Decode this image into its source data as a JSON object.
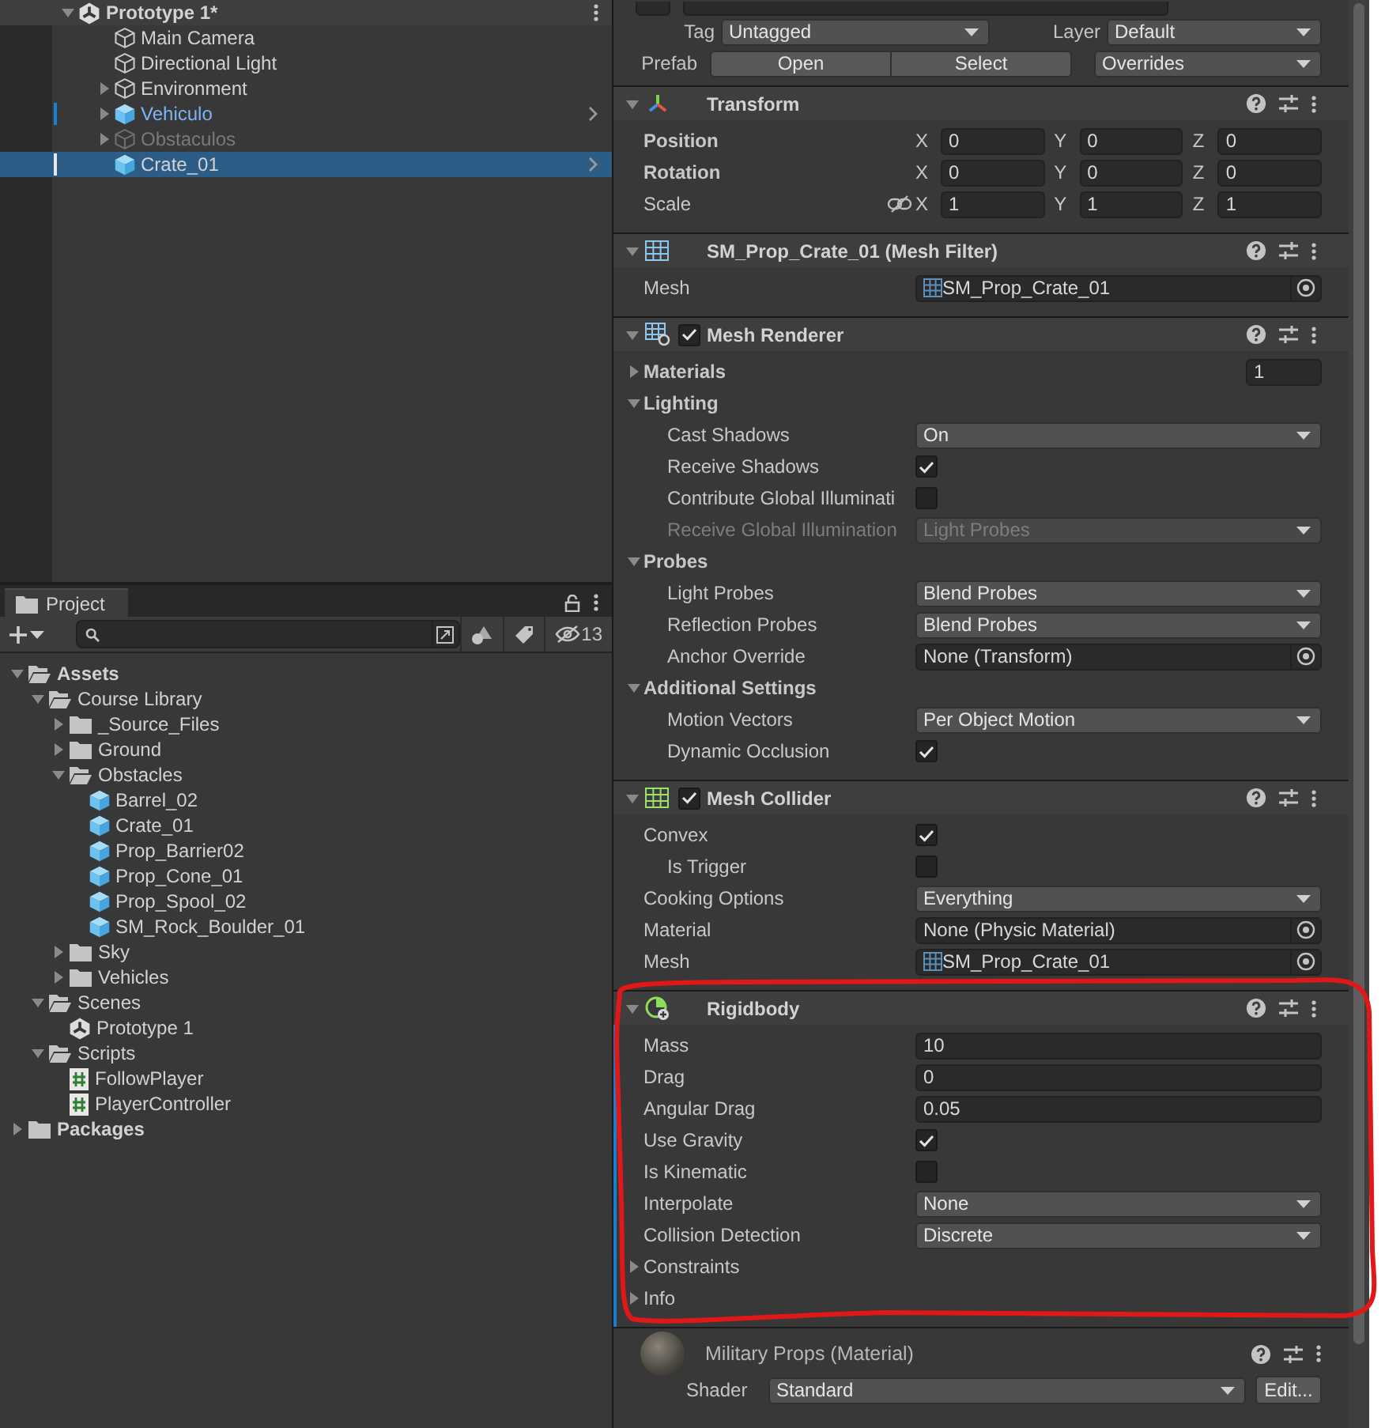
{
  "hierarchy": {
    "scene": {
      "label": "Prototype 1*",
      "expanded": true,
      "children": [
        {
          "label": "Main Camera",
          "kind": "object",
          "selected": false,
          "active": true,
          "overridden": false
        },
        {
          "label": "Directional Light",
          "kind": "object",
          "selected": false,
          "active": true,
          "overridden": false
        },
        {
          "label": "Environment",
          "kind": "object",
          "expanded": false,
          "selected": false,
          "active": true,
          "overridden": false
        },
        {
          "label": "Vehiculo",
          "kind": "prefab",
          "expanded": false,
          "selected": false,
          "active": true,
          "overridden": true
        },
        {
          "label": "Obstaculos",
          "kind": "object",
          "expanded": false,
          "selected": false,
          "active": false,
          "overridden": false
        },
        {
          "label": "Crate_01",
          "kind": "prefab",
          "selected": true,
          "active": true,
          "overridden": false
        }
      ]
    }
  },
  "project": {
    "tab": "Project",
    "hidden_count": "13",
    "tree": [
      {
        "label": "Assets",
        "kind": "folder",
        "expanded": true,
        "children": [
          {
            "label": "Course Library",
            "kind": "folder",
            "expanded": true,
            "children": [
              {
                "label": "_Source_Files",
                "kind": "folder",
                "expanded": false
              },
              {
                "label": "Ground",
                "kind": "folder",
                "expanded": false
              },
              {
                "label": "Obstacles",
                "kind": "folder",
                "expanded": true,
                "children": [
                  {
                    "label": "Barrel_02",
                    "kind": "prefab"
                  },
                  {
                    "label": "Crate_01",
                    "kind": "prefab"
                  },
                  {
                    "label": "Prop_Barrier02",
                    "kind": "prefab"
                  },
                  {
                    "label": "Prop_Cone_01",
                    "kind": "prefab"
                  },
                  {
                    "label": "Prop_Spool_02",
                    "kind": "prefab"
                  },
                  {
                    "label": "SM_Rock_Boulder_01",
                    "kind": "prefab"
                  }
                ]
              },
              {
                "label": "Sky",
                "kind": "folder",
                "expanded": false
              },
              {
                "label": "Vehicles",
                "kind": "folder",
                "expanded": false
              }
            ]
          },
          {
            "label": "Scenes",
            "kind": "folder",
            "expanded": true,
            "children": [
              {
                "label": "Prototype 1",
                "kind": "scene"
              }
            ]
          },
          {
            "label": "Scripts",
            "kind": "folder",
            "expanded": true,
            "children": [
              {
                "label": "FollowPlayer",
                "kind": "script"
              },
              {
                "label": "PlayerController",
                "kind": "script"
              }
            ]
          }
        ]
      },
      {
        "label": "Packages",
        "kind": "folder",
        "expanded": false
      }
    ]
  },
  "inspector": {
    "tag_label": "Tag",
    "tag": "Untagged",
    "layer_label": "Layer",
    "layer": "Default",
    "prefab_label": "Prefab",
    "prefab_buttons": [
      "Open",
      "Select"
    ],
    "overrides": "Overrides",
    "components": [
      {
        "title": "Transform",
        "kind": "transform",
        "expanded": true,
        "added": false,
        "rows": [
          {
            "kind": "vector",
            "label": "Position",
            "modified": true,
            "axes": [
              {
                "axis": "X",
                "value": "0"
              },
              {
                "axis": "Y",
                "value": "0"
              },
              {
                "axis": "Z",
                "value": "0"
              }
            ]
          },
          {
            "kind": "vector",
            "label": "Rotation",
            "modified": true,
            "axes": [
              {
                "axis": "X",
                "value": "0"
              },
              {
                "axis": "Y",
                "value": "0"
              },
              {
                "axis": "Z",
                "value": "0"
              }
            ]
          },
          {
            "kind": "vector",
            "label": "Scale",
            "modified": false,
            "proportional": false,
            "axes": [
              {
                "axis": "X",
                "value": "1"
              },
              {
                "axis": "Y",
                "value": "1"
              },
              {
                "axis": "Z",
                "value": "1"
              }
            ]
          }
        ]
      },
      {
        "title": "SM_Prop_Crate_01 (Mesh Filter)",
        "kind": "mesh_filter",
        "expanded": true,
        "added": false,
        "rows": [
          {
            "kind": "object",
            "label": "Mesh",
            "value": "SM_Prop_Crate_01",
            "asset": true,
            "modified": false
          }
        ]
      },
      {
        "title": "Mesh Renderer",
        "kind": "mesh_renderer",
        "enabled": true,
        "expanded": true,
        "added": false,
        "rows": [
          {
            "kind": "foldout",
            "label": "Materials",
            "expanded": false,
            "value": "1",
            "modified": true
          },
          {
            "kind": "foldout",
            "label": "Lighting",
            "expanded": true,
            "modified": true
          },
          {
            "kind": "dropdown",
            "label": "Cast Shadows",
            "value": "On",
            "indent": true,
            "disabled": false,
            "modified": false
          },
          {
            "kind": "checkbox",
            "label": "Receive Shadows",
            "checked": true,
            "indent": true,
            "modified": false
          },
          {
            "kind": "checkbox",
            "label": "Contribute Global Illuminati",
            "checked": false,
            "indent": true,
            "modified": false
          },
          {
            "kind": "dropdown",
            "label": "Receive Global Illumination",
            "value": "Light Probes",
            "indent": true,
            "disabled": true,
            "modified": false
          },
          {
            "kind": "foldout",
            "label": "Probes",
            "expanded": true,
            "modified": true
          },
          {
            "kind": "dropdown",
            "label": "Light Probes",
            "value": "Blend Probes",
            "indent": true,
            "disabled": false,
            "modified": false
          },
          {
            "kind": "dropdown",
            "label": "Reflection Probes",
            "value": "Blend Probes",
            "indent": true,
            "disabled": false,
            "modified": false
          },
          {
            "kind": "object",
            "label": "Anchor Override",
            "value": "None (Transform)",
            "indent": true,
            "modified": false
          },
          {
            "kind": "foldout",
            "label": "Additional Settings",
            "expanded": true,
            "modified": true
          },
          {
            "kind": "dropdown",
            "label": "Motion Vectors",
            "value": "Per Object Motion",
            "indent": true,
            "disabled": false,
            "modified": false
          },
          {
            "kind": "checkbox",
            "label": "Dynamic Occlusion",
            "checked": true,
            "indent": true,
            "modified": false
          }
        ]
      },
      {
        "title": "Mesh Collider",
        "kind": "mesh_collider",
        "enabled": true,
        "expanded": true,
        "added": false,
        "rows": [
          {
            "kind": "checkbox",
            "label": "Convex",
            "checked": true,
            "modified": false
          },
          {
            "kind": "checkbox",
            "label": "Is Trigger",
            "checked": false,
            "indent": true,
            "modified": false
          },
          {
            "kind": "dropdown",
            "label": "Cooking Options",
            "value": "Everything",
            "disabled": false,
            "modified": false
          },
          {
            "kind": "object",
            "label": "Material",
            "value": "None (Physic Material)",
            "modified": false
          },
          {
            "kind": "object",
            "label": "Mesh",
            "value": "SM_Prop_Crate_01",
            "asset": true,
            "modified": false
          }
        ]
      },
      {
        "title": "Rigidbody",
        "kind": "rigidbody",
        "expanded": true,
        "added": true,
        "rows": [
          {
            "kind": "field",
            "label": "Mass",
            "value": "10",
            "modified": false
          },
          {
            "kind": "field",
            "label": "Drag",
            "value": "0",
            "modified": false
          },
          {
            "kind": "field",
            "label": "Angular Drag",
            "value": "0.05",
            "modified": false
          },
          {
            "kind": "checkbox",
            "label": "Use Gravity",
            "checked": true,
            "modified": false
          },
          {
            "kind": "checkbox",
            "label": "Is Kinematic",
            "checked": false,
            "modified": false
          },
          {
            "kind": "dropdown",
            "label": "Interpolate",
            "value": "None",
            "disabled": false,
            "modified": false
          },
          {
            "kind": "dropdown",
            "label": "Collision Detection",
            "value": "Discrete",
            "disabled": false,
            "modified": false
          },
          {
            "kind": "foldout",
            "label": "Constraints",
            "expanded": false,
            "modified": false
          },
          {
            "kind": "foldout",
            "label": "Info",
            "expanded": false,
            "modified": false
          }
        ]
      }
    ],
    "material": {
      "title": "Military Props (Material)",
      "shader_label": "Shader",
      "shader": "Standard",
      "edit": "Edit..."
    }
  }
}
